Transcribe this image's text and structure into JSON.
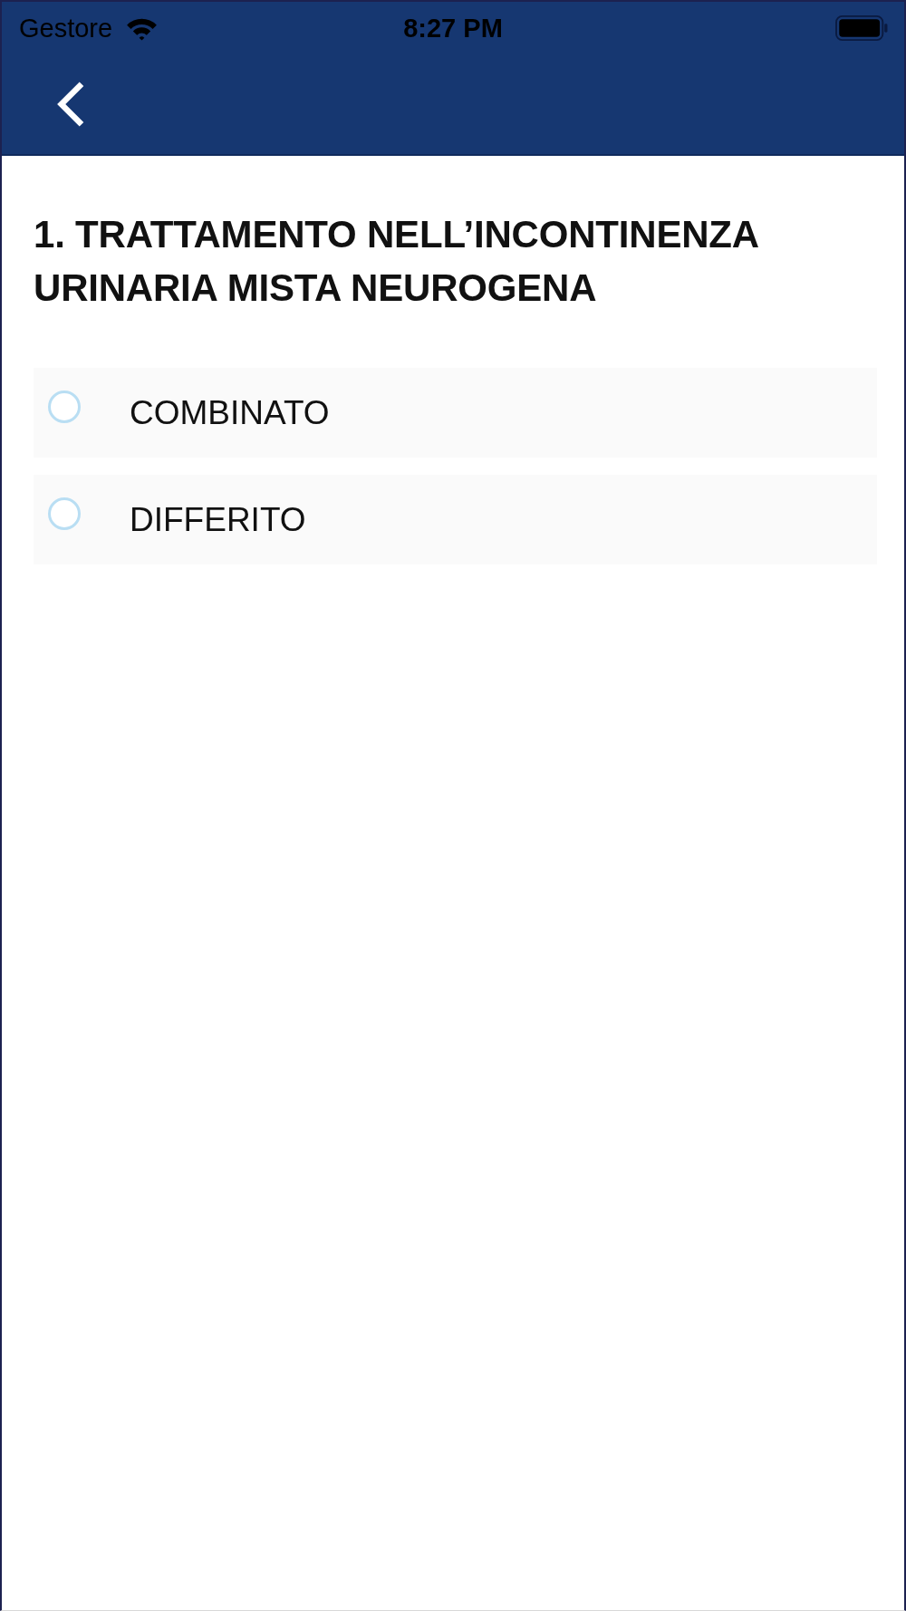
{
  "status_bar": {
    "carrier": "Gestore",
    "time": "8:27 PM"
  },
  "question": {
    "title": "1. TRATTAMENTO NELL’INCONTINENZA URINARIA MISTA NEUROGENA",
    "options": [
      {
        "label": "COMBINATO",
        "selected": false
      },
      {
        "label": "DIFFERITO",
        "selected": false
      }
    ]
  }
}
